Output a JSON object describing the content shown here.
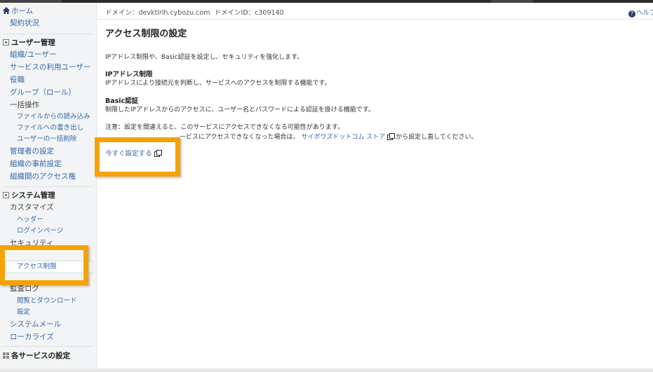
{
  "header": {
    "domain_label": "ドメイン：devktlrlh.cybozu.com",
    "domain_id_label": "ドメインID：c309140",
    "help_label": "ヘルプ"
  },
  "sidebar": {
    "home": "ホーム",
    "contract": "契約状況",
    "user_mgmt": {
      "title": "ユーザー管理",
      "items": [
        "組織/ユーザー",
        "サービスの利用ユーザー",
        "役職",
        "グループ（ロール）",
        "一括操作"
      ],
      "bulk_items": [
        "ファイルからの読み込み",
        "ファイルへの書き出し",
        "ユーザーの一括削除"
      ],
      "more_items": [
        "管理者の設定",
        "組織の事前設定",
        "組織間のアクセス権"
      ]
    },
    "system_mgmt": {
      "title": "システム管理",
      "customize": "カスタマイズ",
      "customize_items": [
        "ヘッダー",
        "ログインページ"
      ],
      "security": "セキュリティ",
      "security_items": [
        "アクセス制限"
      ],
      "audit_log": "監査ログ",
      "audit_items": [
        "閲覧とダウンロード",
        "設定"
      ],
      "system_mail": "システムメール",
      "localize": "ローカライズ"
    },
    "services": "各サービスの設定"
  },
  "main": {
    "title": "アクセス制限の設定",
    "intro": "IPアドレス制限や、Basic認証を設定し、セキュリティを強化します。",
    "ip_title": "IPアドレス制限",
    "ip_desc": "IPアドレスにより接続元を判断し、サービスへのアクセスを制限する機能です。",
    "basic_title": "Basic認証",
    "basic_desc": "制限したIPアドレスからのアクセスに、ユーザー名とパスワードによる認証を掛ける機能です。",
    "note_line1": "注意：設定を間違えると、このサービスにアクセスできなくなる可能性があります。",
    "note_line2_pre": "ービスにアクセスできなくなった場合は、",
    "note_link": "サイボウズドットコム ストア",
    "note_line2_post": "から設定し直してください。",
    "set_now": "今すぐ設定する"
  },
  "colors": {
    "highlight": "#f5a300",
    "link": "#3366aa",
    "sidebar_bg": "#f2f4f5"
  }
}
